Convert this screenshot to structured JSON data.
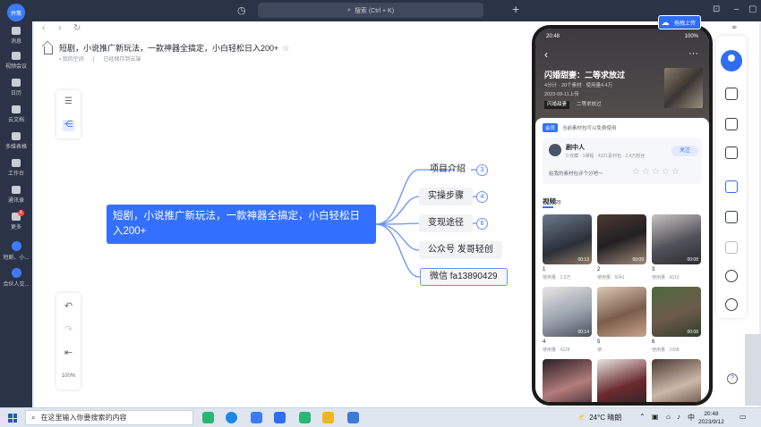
{
  "app": {
    "user_avatar": "并策",
    "search_placeholder": "搜索 (Ctrl + K)",
    "upload_badge": "拖拽上传",
    "rail": [
      {
        "label": "消息",
        "icon": "message-icon"
      },
      {
        "label": "视频会议",
        "icon": "video-icon"
      },
      {
        "label": "日历",
        "icon": "calendar-icon"
      },
      {
        "label": "云文档",
        "icon": "cloud-doc-icon"
      },
      {
        "label": "多维表格",
        "icon": "base-icon"
      },
      {
        "label": "工作台",
        "icon": "workplace-icon"
      },
      {
        "label": "通讯录",
        "icon": "contacts-icon"
      },
      {
        "label": "更多",
        "icon": "more-icon",
        "badge": "1"
      },
      {
        "label": "短剧、小...",
        "icon": "doc-tab-icon",
        "active": true
      },
      {
        "label": "合伙人交...",
        "icon": "doc-tab-icon"
      }
    ]
  },
  "doc": {
    "title": "短剧，小说推广新玩法，一款神器全搞定，小白轻松日入200+",
    "location": "我的空间",
    "save_status": "已经保存到云端",
    "zoom": "100%"
  },
  "mindmap": {
    "root": "短剧，小说推广新玩法，一款神器全搞定，小白轻松日入200+",
    "children": [
      {
        "label": "项目介绍",
        "count": "3"
      },
      {
        "label": "实操步骤",
        "count": "4"
      },
      {
        "label": "变现途径",
        "count": "6"
      },
      {
        "label": "公众号  发哥轻创",
        "count": ""
      },
      {
        "label": "微信   fa13890429",
        "count": ""
      }
    ]
  },
  "phone": {
    "status_time": "20:48",
    "status_right": "100%",
    "title": "闪婚甜妻：二等求放过",
    "meta": "4分计 · 20个素材 · 使用量4.4万",
    "date": "2023-09-11上传",
    "tag1": "闪婚甜妻",
    "tag2": "二等求放过",
    "vip": "会员",
    "vip_note": "当前素材包可以免费使用",
    "author_name": "剧中人",
    "author_stats": "0 收藏 · 1课程 · 4321素材包 · 2.4万粉丝",
    "follow": "关注",
    "rate_prompt": "给我的素材包评个分吧～",
    "stars": "☆☆☆☆☆",
    "videos_heading": "视频",
    "videos_count": "20",
    "videos": [
      {
        "num": "1",
        "usage": "使用量 · 1.0万",
        "dur": "00:13"
      },
      {
        "num": "2",
        "usage": "使用量 · 5041",
        "dur": "00:09"
      },
      {
        "num": "3",
        "usage": "使用量 · 4313",
        "dur": "00:08"
      },
      {
        "num": "4",
        "usage": "使用量 · 4228",
        "dur": "00:14"
      },
      {
        "num": "5",
        "usage": "使...",
        "dur": ""
      },
      {
        "num": "6",
        "usage": "使用量 · 1938",
        "dur": "00:08"
      }
    ]
  },
  "taskbar": {
    "search": "在这里输入你要搜索的内容",
    "weather": "24°C 晴朗",
    "lang": "中",
    "time": "20:48",
    "date": "2023/9/12"
  }
}
